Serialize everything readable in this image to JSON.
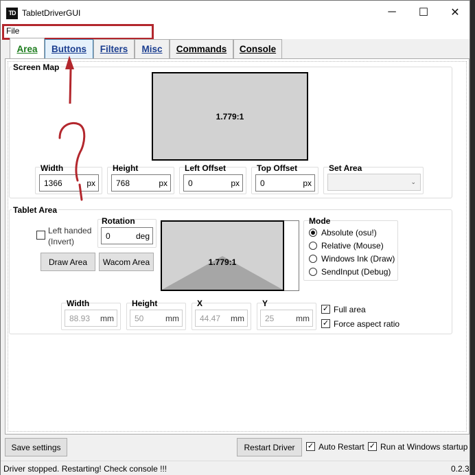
{
  "window": {
    "icon_text": "TD",
    "title": "TabletDriverGUI"
  },
  "caption": {
    "minimize": "─",
    "maximize": "☐",
    "close": "✕"
  },
  "menu": {
    "file": "File"
  },
  "tabs": [
    {
      "label": "Area"
    },
    {
      "label": "Buttons"
    },
    {
      "label": "Filters"
    },
    {
      "label": "Misc"
    },
    {
      "label": "Commands"
    },
    {
      "label": "Console"
    }
  ],
  "screen_map": {
    "title": "Screen Map",
    "ratio": "1.779:1",
    "width": {
      "label": "Width",
      "value": "1366",
      "unit": "px"
    },
    "height": {
      "label": "Height",
      "value": "768",
      "unit": "px"
    },
    "left_offset": {
      "label": "Left Offset",
      "value": "0",
      "unit": "px"
    },
    "top_offset": {
      "label": "Top Offset",
      "value": "0",
      "unit": "px"
    },
    "set_area": {
      "label": "Set Area",
      "value": ""
    }
  },
  "tablet_area": {
    "title": "Tablet Area",
    "left_handed": "Left handed\n(Invert)",
    "rotation": {
      "label": "Rotation",
      "value": "0",
      "unit": "deg"
    },
    "draw_area_button": "Draw Area",
    "wacom_area_button": "Wacom Area",
    "ratio": "1.779:1",
    "mode": {
      "label": "Mode",
      "options": [
        "Absolute (osu!)",
        "Relative (Mouse)",
        "Windows Ink (Draw)",
        "SendInput (Debug)"
      ],
      "selected": 0
    },
    "width": {
      "label": "Width",
      "value": "88.93",
      "unit": "mm"
    },
    "height": {
      "label": "Height",
      "value": "50",
      "unit": "mm"
    },
    "x": {
      "label": "X",
      "value": "44.47",
      "unit": "mm"
    },
    "y": {
      "label": "Y",
      "value": "25",
      "unit": "mm"
    },
    "full_area": {
      "label": "Full area",
      "checked": true
    },
    "force_aspect": {
      "label": "Force aspect ratio",
      "checked": true
    }
  },
  "bottom": {
    "save_settings": "Save settings",
    "restart_driver": "Restart Driver",
    "auto_restart": {
      "label": "Auto Restart",
      "checked": true
    },
    "run_startup": {
      "label": "Run at Windows startup",
      "checked": true
    }
  },
  "status": {
    "message": "Driver stopped. Restarting! Check console !!!",
    "version": "0.2.3"
  },
  "colors": {
    "annotation_red": "#b3272d",
    "active_tab": "#1b7b1b",
    "tab_blue": "#1a3d8f"
  }
}
